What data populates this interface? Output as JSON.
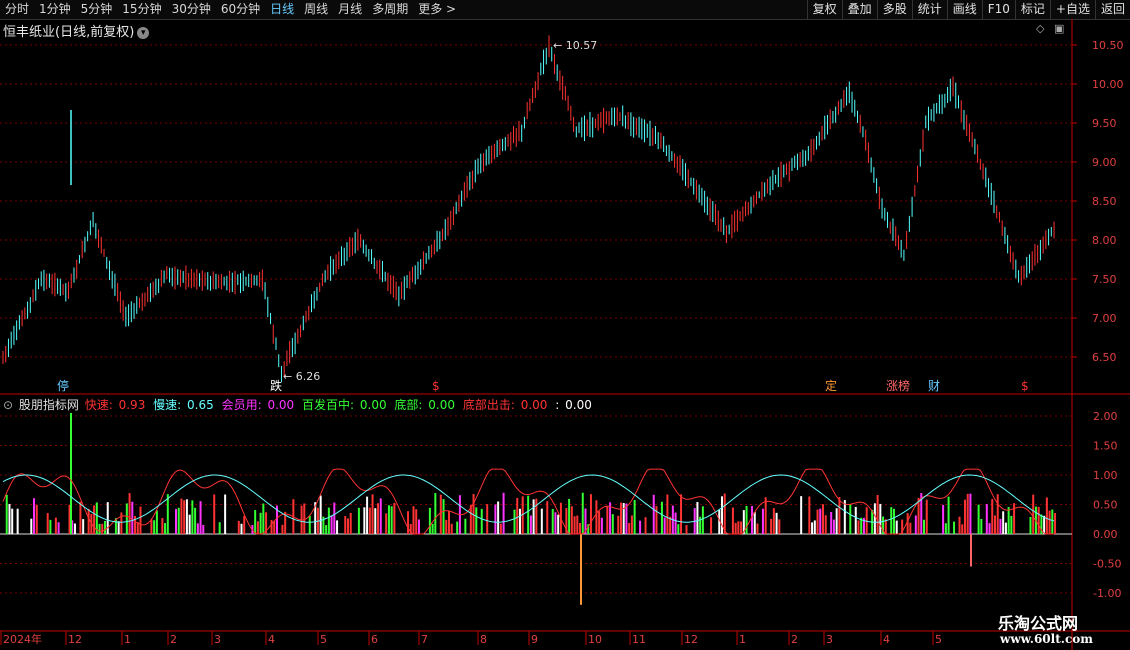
{
  "toolbar": {
    "periods": [
      "分时",
      "1分钟",
      "5分钟",
      "15分钟",
      "30分钟",
      "60分钟",
      "日线",
      "周线",
      "月线",
      "多周期",
      "更多 >"
    ],
    "active_period": "日线",
    "right_buttons": [
      "复权",
      "叠加",
      "多股",
      "统计",
      "画线",
      "F10",
      "标记",
      "+自选",
      "返回"
    ]
  },
  "chart_title": "恒丰纸业(日线,前复权)",
  "price_axis": [
    "10.50",
    "10.00",
    "9.50",
    "9.00",
    "8.50",
    "8.00",
    "7.50",
    "7.00",
    "6.50"
  ],
  "price_high_label": "10.57",
  "price_low_label": "6.26",
  "markers": [
    {
      "text": "停",
      "color": "#66ccff"
    },
    {
      "text": "跌",
      "color": "#ffffff"
    },
    {
      "text": "$",
      "color": "#ff3333"
    },
    {
      "text": "定",
      "color": "#ff9933"
    },
    {
      "text": "涨榜",
      "color": "#ff6666"
    },
    {
      "text": "财",
      "color": "#66ccff"
    },
    {
      "text": "$",
      "color": "#ff3333"
    }
  ],
  "indicator": {
    "name": "股朋指标网",
    "fields": [
      {
        "label": "快速:",
        "value": "0.93",
        "color": "#ff3333"
      },
      {
        "label": "慢速:",
        "value": "0.65",
        "color": "#66ffff"
      },
      {
        "label": "会员用:",
        "value": "0.00",
        "color": "#ff33ff"
      },
      {
        "label": "百发百中:",
        "value": "0.00",
        "color": "#33ff33"
      },
      {
        "label": "底部:",
        "value": "0.00",
        "color": "#33ff33"
      },
      {
        "label": "底部出击:",
        "value": "0.00",
        "color": "#ff3333"
      },
      {
        "label": ":",
        "value": "0.00",
        "color": "#ffffff"
      }
    ],
    "axis": [
      "2.00",
      "1.50",
      "1.00",
      "0.50",
      "0.00",
      "-0.50",
      "-1.00"
    ]
  },
  "time_axis": [
    "2024年",
    "12",
    "1",
    "2",
    "3",
    "4",
    "5",
    "6",
    "7",
    "8",
    "9",
    "10",
    "11",
    "12",
    "1",
    "2",
    "3",
    "4",
    "5"
  ],
  "watermark": {
    "name": "乐淘公式网",
    "url": "www.60lt.com"
  },
  "colors": {
    "up": "#ff3333",
    "down": "#54ffff",
    "grid": "#7a0000",
    "axis": "#c00000"
  }
}
